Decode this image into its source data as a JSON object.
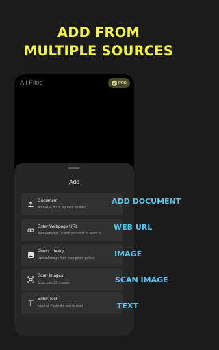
{
  "headline": {
    "line1": "ADD FROM",
    "line2": "MULTIPLE SOURCES"
  },
  "phone": {
    "title": "All Files",
    "pro_badge": "PRO"
  },
  "sheet": {
    "title": "Add",
    "options": [
      {
        "icon": "upload-icon",
        "title": "Document",
        "subtitle": "Add PDF, docx, epub or txt files",
        "callout": "ADD DOCUMENT"
      },
      {
        "icon": "link-icon",
        "title": "Enter Webpage URL",
        "subtitle": "Add webpage url that you want to listen to",
        "callout": "WEB URL"
      },
      {
        "icon": "image-icon",
        "title": "Photo Library",
        "subtitle": "Upload image from your photo gallery",
        "callout": "IMAGE"
      },
      {
        "icon": "scan-icon",
        "title": "Scan Images",
        "subtitle": "Scan upto 20 images",
        "callout": "SCAN IMAGE"
      },
      {
        "icon": "text-icon",
        "title": "Enter Text",
        "subtitle": "Input or Paste the text to read",
        "callout": "TEXT"
      }
    ]
  },
  "colors": {
    "headline": "#f2f24a",
    "callout": "#5ec3ee",
    "background": "#1b1b1b"
  }
}
